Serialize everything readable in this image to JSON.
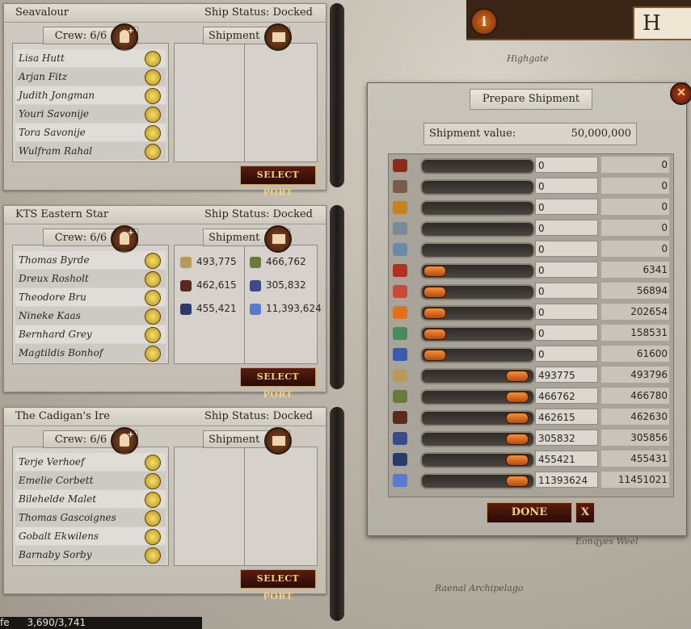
{
  "top": {
    "title_partial": "H"
  },
  "map_labels": {
    "highgate": "Highgate",
    "archipelago": "Raenal Archipelago",
    "lower_right": "Eonqyes Weel"
  },
  "ships": [
    {
      "name": "Seavalour",
      "status": "Ship Status: Docked",
      "crew_label": "Crew: 6/6",
      "shipment_label": "Shipment",
      "crew": [
        "Lisa Hutt",
        "Arjan Fitz",
        "Judith Jongman",
        "Youri Savonije",
        "Tora Savonije",
        "Wulfram Rahal"
      ],
      "cargo": [],
      "select_port_label": "SELECT PORT"
    },
    {
      "name": "KTS Eastern Star",
      "status": "Ship Status: Docked",
      "crew_label": "Crew: 6/6",
      "shipment_label": "Shipment",
      "crew": [
        "Thomas Byrde",
        "Dreux Rosholt",
        "Theodore Bru",
        "Nineke Kaas",
        "Bernhard Grey",
        "Magtildis Bonhof"
      ],
      "cargo": [
        {
          "icon": "wheat-icon",
          "value": "493,775"
        },
        {
          "icon": "herb-icon",
          "value": "466,762"
        },
        {
          "icon": "fruit-icon",
          "value": "462,615"
        },
        {
          "icon": "ore-icon",
          "value": "305,832"
        },
        {
          "icon": "coal-icon",
          "value": "455,421"
        },
        {
          "icon": "crystal-icon",
          "value": "11,393,624"
        }
      ],
      "select_port_label": "SELECT PORT"
    },
    {
      "name": "The Cadigan's Ire",
      "status": "Ship Status: Docked",
      "crew_label": "Crew: 6/6",
      "shipment_label": "Shipment",
      "crew": [
        "Terje Verhoef",
        "Emelie Corbett",
        "Bilehelde Malet",
        "Thomas Gascoignes",
        "Gobalt Ekwilens",
        "Barnaby Sorby"
      ],
      "cargo": [],
      "select_port_label": "SELECT PORT"
    }
  ],
  "dialog": {
    "title": "Prepare Shipment",
    "value_label": "Shipment value:",
    "value": "50,000,000",
    "done_label": "DONE",
    "cancel_label": "X",
    "goods": [
      {
        "icon": "meat-icon",
        "color": "#8a2a1a",
        "value": "0",
        "max": "0",
        "fill": 0
      },
      {
        "icon": "leather-icon",
        "color": "#7a5a4a",
        "value": "0",
        "max": "0",
        "fill": 0
      },
      {
        "icon": "grain-sack-icon",
        "color": "#c8821a",
        "value": "0",
        "max": "0",
        "fill": 0
      },
      {
        "icon": "tools-icon",
        "color": "#7a8a9a",
        "value": "0",
        "max": "0",
        "fill": 0
      },
      {
        "icon": "silver-icon",
        "color": "#6a8aaa",
        "value": "0",
        "max": "0",
        "fill": 0
      },
      {
        "icon": "cloth-red-icon",
        "color": "#b2301e",
        "value": "0",
        "max": "6341",
        "fill": 0
      },
      {
        "icon": "cloth-stripe-icon",
        "color": "#c84a3a",
        "value": "0",
        "max": "56894",
        "fill": 0
      },
      {
        "icon": "cloth-orange-icon",
        "color": "#e0701a",
        "value": "0",
        "max": "202654",
        "fill": 0
      },
      {
        "icon": "cloth-green-icon",
        "color": "#4a8a5a",
        "value": "0",
        "max": "158531",
        "fill": 0
      },
      {
        "icon": "cloth-blue-icon",
        "color": "#3a5ab2",
        "value": "0",
        "max": "61600",
        "fill": 0
      },
      {
        "icon": "wheat-icon",
        "color": "#b89a5a",
        "value": "493775",
        "max": "493796",
        "fill": 1
      },
      {
        "icon": "herb-icon",
        "color": "#6a7a3a",
        "value": "466762",
        "max": "466780",
        "fill": 1
      },
      {
        "icon": "fruit-icon",
        "color": "#5a2a1a",
        "value": "462615",
        "max": "462630",
        "fill": 1
      },
      {
        "icon": "ore-icon",
        "color": "#3a4a8a",
        "value": "305832",
        "max": "305856",
        "fill": 1
      },
      {
        "icon": "coal-icon",
        "color": "#2a3a6a",
        "value": "455421",
        "max": "455431",
        "fill": 1
      },
      {
        "icon": "crystal-icon",
        "color": "#5a7ad2",
        "value": "11393624",
        "max": "11451021",
        "fill": 1
      }
    ]
  },
  "bottom": {
    "left_text": "fe",
    "counter": "3,690/3,741"
  }
}
